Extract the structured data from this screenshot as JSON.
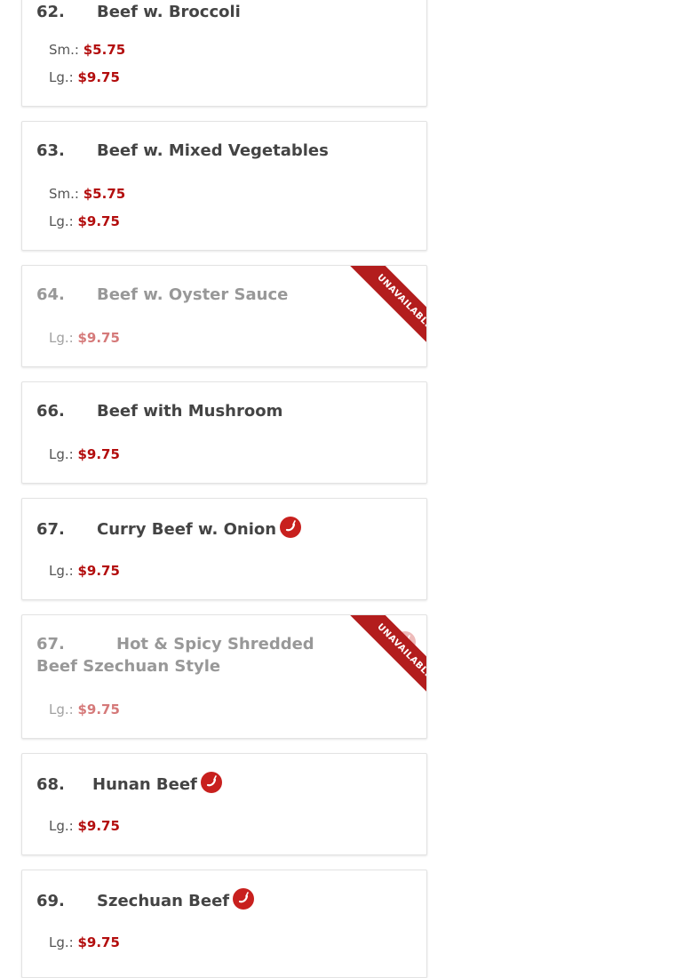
{
  "items": [
    {
      "number": "62.",
      "name": "Beef w. Broccoli",
      "spicy": false,
      "unavailable": false,
      "sizes": [
        {
          "label": "Sm.:",
          "price": "$5.75"
        },
        {
          "label": "Lg.:",
          "price": "$9.75"
        }
      ]
    },
    {
      "number": "63.",
      "name": "Beef w. Mixed Vegetables",
      "spicy": false,
      "unavailable": false,
      "sizes": [
        {
          "label": "Sm.:",
          "price": "$5.75"
        },
        {
          "label": "Lg.:",
          "price": "$9.75"
        }
      ]
    },
    {
      "number": "64.",
      "name": "Beef w. Oyster Sauce",
      "spicy": false,
      "unavailable": true,
      "sizes": [
        {
          "label": "Lg.:",
          "price": "$9.75"
        }
      ]
    },
    {
      "number": "66.",
      "name": "Beef with Mushroom",
      "spicy": false,
      "unavailable": false,
      "sizes": [
        {
          "label": "Lg.:",
          "price": "$9.75"
        }
      ]
    },
    {
      "number": "67.",
      "name": "Curry Beef w. Onion",
      "spicy": true,
      "unavailable": false,
      "sizes": [
        {
          "label": "Lg.:",
          "price": "$9.75"
        }
      ]
    },
    {
      "number": "67.",
      "name": "Hot & Spicy Shredded Beef Szechuan Style",
      "spicy": true,
      "unavailable": true,
      "sizes": [
        {
          "label": "Lg.:",
          "price": "$9.75"
        }
      ]
    },
    {
      "number": "68.",
      "name": "Hunan Beef",
      "spicy": true,
      "unavailable": false,
      "sizes": [
        {
          "label": "Lg.:",
          "price": "$9.75"
        }
      ]
    },
    {
      "number": "69.",
      "name": "Szechuan Beef",
      "spicy": true,
      "unavailable": false,
      "sizes": [
        {
          "label": "Lg.:",
          "price": "$9.75"
        }
      ]
    }
  ],
  "ribbon_label": "UNAVAILABLE",
  "icons": {
    "spicy": "chili-pepper-icon"
  },
  "colors": {
    "price": "#b30d0d",
    "ribbon": "#b31d1d",
    "chili": "#c8201e"
  }
}
